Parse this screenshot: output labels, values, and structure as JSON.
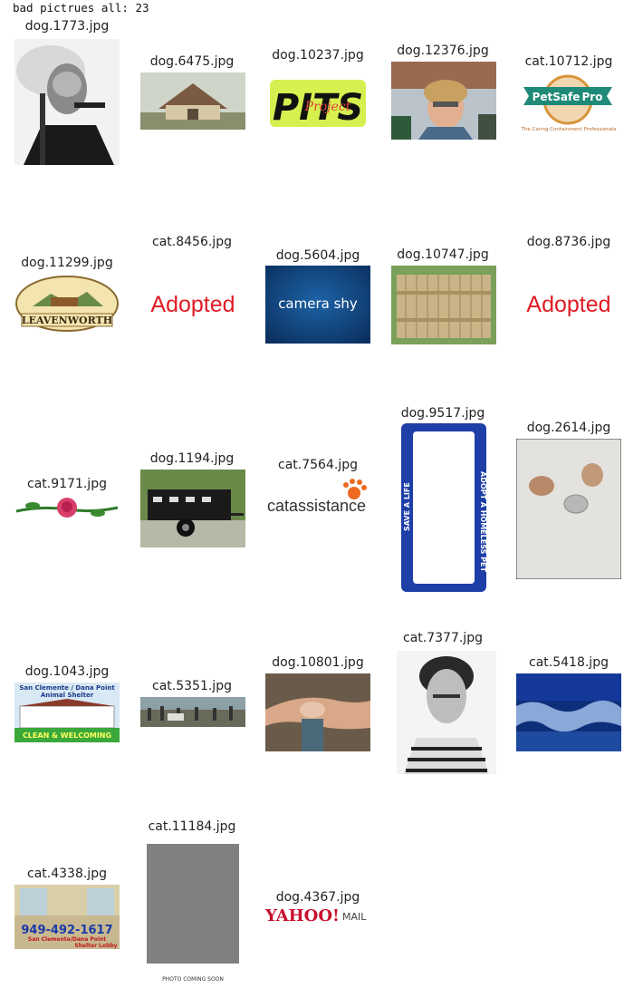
{
  "header": {
    "text": "bad pictrues all: 23"
  },
  "images": [
    {
      "name": "dog.1773.jpg"
    },
    {
      "name": "dog.6475.jpg"
    },
    {
      "name": "dog.10237.jpg"
    },
    {
      "name": "dog.12376.jpg"
    },
    {
      "name": "cat.10712.jpg"
    },
    {
      "name": "dog.11299.jpg"
    },
    {
      "name": "cat.8456.jpg"
    },
    {
      "name": "dog.5604.jpg"
    },
    {
      "name": "dog.10747.jpg"
    },
    {
      "name": "dog.8736.jpg"
    },
    {
      "name": "cat.9171.jpg"
    },
    {
      "name": "dog.1194.jpg"
    },
    {
      "name": "cat.7564.jpg"
    },
    {
      "name": "dog.9517.jpg"
    },
    {
      "name": "dog.2614.jpg"
    },
    {
      "name": "dog.1043.jpg"
    },
    {
      "name": "cat.5351.jpg"
    },
    {
      "name": "dog.10801.jpg"
    },
    {
      "name": "cat.7377.jpg"
    },
    {
      "name": "cat.5418.jpg"
    },
    {
      "name": "cat.4338.jpg"
    },
    {
      "name": "cat.11184.jpg"
    },
    {
      "name": "dog.4367.jpg"
    }
  ],
  "image_text": {
    "pits_word": "PITS",
    "pits_sub": "Project",
    "petsafe_title": "PetSafe",
    "petsafe_pro": "Pro",
    "petsafe_tag": "The Caring Containment Professionals",
    "leavenworth": "LEAVENWORTH",
    "adopted_1": "Adopted",
    "camera_shy": "camera shy",
    "adopted_2": "Adopted",
    "catassistance": "catassistance",
    "plate_left": "SAVE A LIFE",
    "plate_right": "ADOPT A HOMELESS PET",
    "shelter_title": "San Clemente / Dana Point",
    "shelter_sub": "Animal Shelter",
    "shelter_banner": "CLEAN & WELCOMING",
    "lobby_phone": "949-492-1617",
    "lobby_line1": "San Clemente/Dana Point",
    "lobby_line2": "Shelter Lobby",
    "photo_coming": "PHOTO COMING SOON",
    "yahoo": "YAHOO!",
    "mail": "MAIL"
  }
}
